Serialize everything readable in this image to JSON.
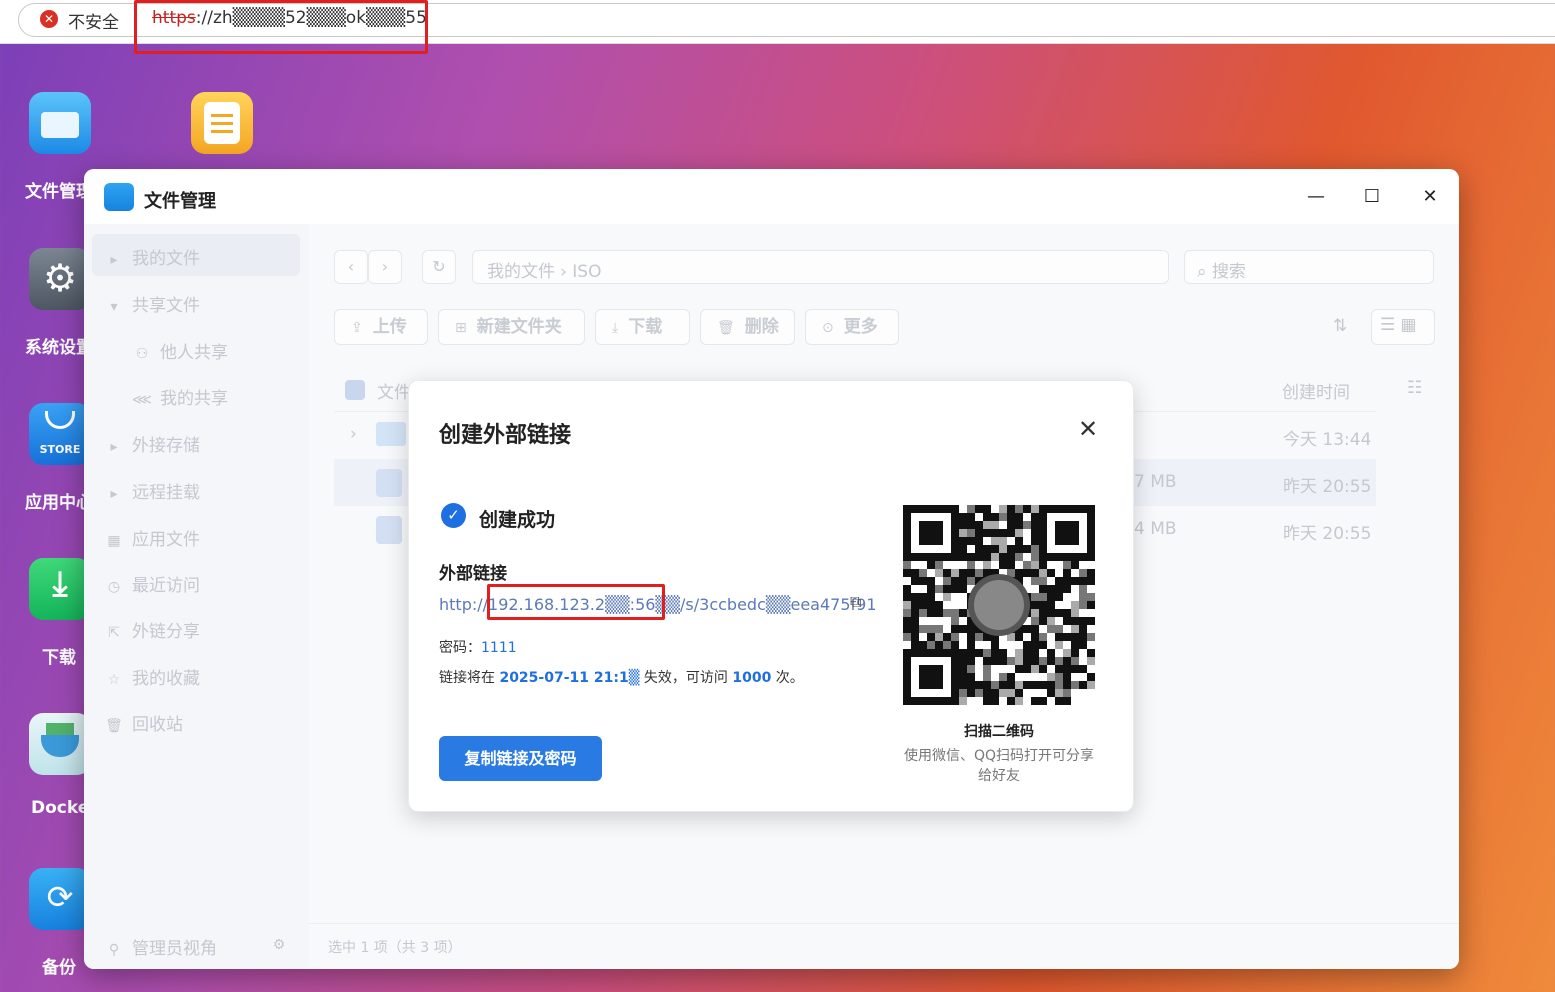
{
  "browser": {
    "security_text": "不安全",
    "url_scheme": "https",
    "url_rest": "://zh▒▒▒▒52▒▒▒ok▒▒▒55"
  },
  "desktop": {
    "icons": [
      {
        "label": "文件管理"
      },
      {
        "label": ""
      },
      {
        "label": "系统设置"
      },
      {
        "label": "应用中心",
        "store_text": "STORE"
      },
      {
        "label": "下载"
      },
      {
        "label": "Docker"
      },
      {
        "label": "备份"
      }
    ]
  },
  "window": {
    "title": "文件管理",
    "sidebar": {
      "items": [
        {
          "label": "我的文件"
        },
        {
          "label": "共享文件"
        },
        {
          "label": "他人共享"
        },
        {
          "label": "我的共享"
        },
        {
          "label": "外接存储"
        },
        {
          "label": "远程挂载"
        },
        {
          "label": "应用文件"
        },
        {
          "label": "最近访问"
        },
        {
          "label": "外链分享"
        },
        {
          "label": "我的收藏"
        },
        {
          "label": "回收站"
        }
      ],
      "footer_label": "管理员视角"
    },
    "breadcrumb": {
      "root": "我的文件",
      "current": "ISO"
    },
    "search_placeholder": "搜索",
    "toolbar": {
      "upload": "上传",
      "new_folder": "新建文件夹",
      "download": "下载",
      "delete": "删除",
      "more": "更多"
    },
    "table": {
      "header_name": "文件",
      "header_created": "创建时间",
      "rows": [
        {
          "size": "",
          "created": "今天 13:44"
        },
        {
          "size": "7 MB",
          "created": "昨天 20:55"
        },
        {
          "size": "4 MB",
          "created": "昨天 20:55"
        }
      ]
    },
    "status": "选中 1 项（共 3 项）"
  },
  "modal": {
    "title": "创建外部链接",
    "success_text": "创建成功",
    "link_label": "外部链接",
    "link_url": "http://192.168.123.2▒▒:56▒▒/s/3ccbedc▒▒eea475f91",
    "password_label": "密码：",
    "password_value": "1111",
    "expiry_prefix": "链接将在 ",
    "expiry_date": "2025-07-11 21:1▒",
    "expiry_mid": " 失效，可访问 ",
    "expiry_count": "1000",
    "expiry_suffix": " 次。",
    "copy_button": "复制链接及密码",
    "qr_title": "扫描二维码",
    "qr_desc": "使用微信、QQ扫码打开可分享给好友"
  },
  "colors": {
    "accent": "#2a7ae4",
    "highlight_box": "#e02020",
    "warning": "#d93025"
  }
}
